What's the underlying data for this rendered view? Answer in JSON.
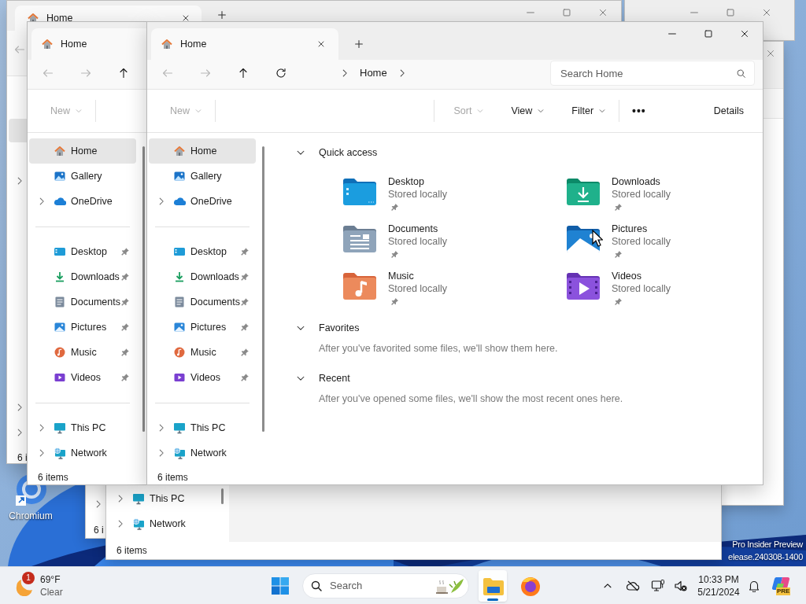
{
  "desktop": {
    "shortcuts": [
      {
        "label": "Chromium"
      }
    ],
    "watermark": [
      "Pro Insider Preview",
      "elease.240308-1400"
    ]
  },
  "background_windows": [
    {
      "tabs": [
        {
          "title": "Home",
          "selected": true
        }
      ],
      "status": "6 i"
    },
    {
      "sidebar": [
        {
          "label": "This PC",
          "kind": "thispc",
          "expandable": true
        },
        {
          "label": "Network",
          "kind": "network",
          "expandable": true
        }
      ],
      "status": "6 items"
    },
    {
      "status": "6 i"
    }
  ],
  "explorers": [
    {
      "tabs": [
        {
          "title": "Home",
          "selected": true
        }
      ],
      "nav": [
        {
          "kind": "back",
          "disabled": true
        },
        {
          "kind": "forward",
          "disabled": true
        },
        {
          "kind": "up",
          "disabled": false
        }
      ],
      "commands": [
        {
          "label": "New",
          "kind": "dropdown",
          "disabled": true
        }
      ],
      "sidebar": [
        [
          {
            "label": "Home",
            "kind": "home",
            "selected": true,
            "expandable": false,
            "pinned": false
          },
          {
            "label": "Gallery",
            "kind": "gallery",
            "selected": false,
            "expandable": false,
            "pinned": false
          },
          {
            "label": "OneDrive",
            "kind": "onedrive",
            "selected": false,
            "expandable": true,
            "pinned": false
          }
        ],
        [
          {
            "label": "Desktop",
            "kind": "desktop",
            "selected": false,
            "expandable": false,
            "pinned": true
          },
          {
            "label": "Downloads",
            "kind": "downloads",
            "selected": false,
            "expandable": false,
            "pinned": true
          },
          {
            "label": "Documents",
            "kind": "documents",
            "selected": false,
            "expandable": false,
            "pinned": true
          },
          {
            "label": "Pictures",
            "kind": "pictures",
            "selected": false,
            "expandable": false,
            "pinned": true
          },
          {
            "label": "Music",
            "kind": "music",
            "selected": false,
            "expandable": false,
            "pinned": true
          },
          {
            "label": "Videos",
            "kind": "videos",
            "selected": false,
            "expandable": false,
            "pinned": true
          }
        ],
        [
          {
            "label": "This PC",
            "kind": "thispc",
            "selected": false,
            "expandable": true,
            "pinned": false
          },
          {
            "label": "Network",
            "kind": "network",
            "selected": false,
            "expandable": true,
            "pinned": false
          }
        ]
      ],
      "status": "6 items"
    },
    {
      "tabs": [
        {
          "title": "Home",
          "selected": true
        }
      ],
      "nav": [
        {
          "kind": "back",
          "disabled": true
        },
        {
          "kind": "forward",
          "disabled": true
        },
        {
          "kind": "up",
          "disabled": false
        },
        {
          "kind": "refresh",
          "disabled": false
        }
      ],
      "breadcrumbs": [
        "Home"
      ],
      "search": {
        "placeholder": "Search Home"
      },
      "commands": [
        {
          "label": "New",
          "kind": "dropdown",
          "disabled": true
        }
      ],
      "commands_right": [
        {
          "label": "Sort",
          "kind": "dropdown",
          "disabled": true
        },
        {
          "label": "View",
          "kind": "dropdown",
          "disabled": false
        },
        {
          "label": "Filter",
          "kind": "dropdown",
          "disabled": false
        },
        {
          "label": "•••",
          "kind": "more",
          "disabled": false
        },
        {
          "label": "Details",
          "kind": "pane",
          "disabled": false
        }
      ],
      "sidebar": [
        [
          {
            "label": "Home",
            "kind": "home",
            "selected": true,
            "expandable": false,
            "pinned": false
          },
          {
            "label": "Gallery",
            "kind": "gallery",
            "selected": false,
            "expandable": false,
            "pinned": false
          },
          {
            "label": "OneDrive",
            "kind": "onedrive",
            "selected": false,
            "expandable": true,
            "pinned": false
          }
        ],
        [
          {
            "label": "Desktop",
            "kind": "desktop",
            "selected": false,
            "expandable": false,
            "pinned": true
          },
          {
            "label": "Downloads",
            "kind": "downloads",
            "selected": false,
            "expandable": false,
            "pinned": true
          },
          {
            "label": "Documents",
            "kind": "documents",
            "selected": false,
            "expandable": false,
            "pinned": true
          },
          {
            "label": "Pictures",
            "kind": "pictures",
            "selected": false,
            "expandable": false,
            "pinned": true
          },
          {
            "label": "Music",
            "kind": "music",
            "selected": false,
            "expandable": false,
            "pinned": true
          },
          {
            "label": "Videos",
            "kind": "videos",
            "selected": false,
            "expandable": false,
            "pinned": true
          }
        ],
        [
          {
            "label": "This PC",
            "kind": "thispc",
            "selected": false,
            "expandable": true,
            "pinned": false
          },
          {
            "label": "Network",
            "kind": "network",
            "selected": false,
            "expandable": true,
            "pinned": false
          }
        ]
      ],
      "sections": [
        {
          "title": "Quick access",
          "expanded": true,
          "items": [
            {
              "name": "Desktop",
              "subtitle": "Stored locally",
              "kind": "desktop",
              "pinned": true
            },
            {
              "name": "Downloads",
              "subtitle": "Stored locally",
              "kind": "downloads",
              "pinned": true
            },
            {
              "name": "Documents",
              "subtitle": "Stored locally",
              "kind": "documents",
              "pinned": true
            },
            {
              "name": "Pictures",
              "subtitle": "Stored locally",
              "kind": "pictures",
              "pinned": true
            },
            {
              "name": "Music",
              "subtitle": "Stored locally",
              "kind": "music",
              "pinned": true
            },
            {
              "name": "Videos",
              "subtitle": "Stored locally",
              "kind": "videos",
              "pinned": true
            }
          ]
        },
        {
          "title": "Favorites",
          "expanded": true,
          "message": "After you've favorited some files, we'll show them here."
        },
        {
          "title": "Recent",
          "expanded": true,
          "message": "After you've opened some files, we'll show the most recent ones here."
        }
      ],
      "status": "6 items"
    }
  ],
  "taskbar": {
    "weather": {
      "badge": "1",
      "temperature": "69°F",
      "condition": "Clear"
    },
    "search": {
      "placeholder": "Search"
    },
    "apps": [
      {
        "kind": "explorer",
        "selected": true
      },
      {
        "kind": "firefox",
        "selected": false
      }
    ],
    "clock": {
      "time": "10:33 PM",
      "date": "5/21/2024"
    },
    "assistant_badge": "PRE"
  }
}
